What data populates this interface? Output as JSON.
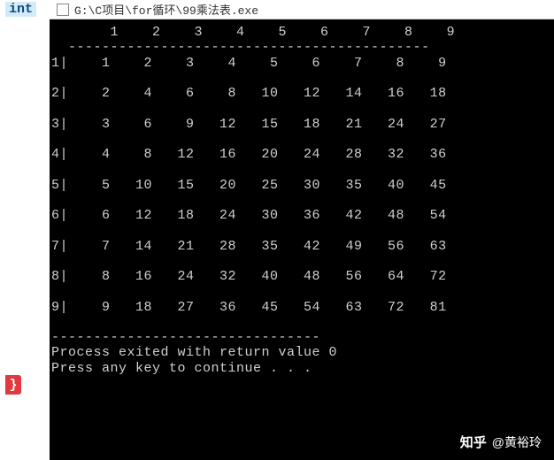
{
  "editor": {
    "keyword": "int",
    "brace": "}"
  },
  "window": {
    "title": "G:\\C项目\\for循环\\99乘法表.exe"
  },
  "chart_data": {
    "type": "table",
    "title": "9x9 multiplication table",
    "col_headers": [
      1,
      2,
      3,
      4,
      5,
      6,
      7,
      8,
      9
    ],
    "row_headers": [
      1,
      2,
      3,
      4,
      5,
      6,
      7,
      8,
      9
    ],
    "rows": [
      [
        1,
        2,
        3,
        4,
        5,
        6,
        7,
        8,
        9
      ],
      [
        2,
        4,
        6,
        8,
        10,
        12,
        14,
        16,
        18
      ],
      [
        3,
        6,
        9,
        12,
        15,
        18,
        21,
        24,
        27
      ],
      [
        4,
        8,
        12,
        16,
        20,
        24,
        28,
        32,
        36
      ],
      [
        5,
        10,
        15,
        20,
        25,
        30,
        35,
        40,
        45
      ],
      [
        6,
        12,
        18,
        24,
        30,
        36,
        42,
        48,
        54
      ],
      [
        7,
        14,
        21,
        28,
        35,
        42,
        49,
        56,
        63
      ],
      [
        8,
        16,
        24,
        32,
        40,
        48,
        56,
        64,
        72
      ],
      [
        9,
        18,
        27,
        36,
        45,
        54,
        63,
        72,
        81
      ]
    ]
  },
  "console": {
    "divider_top": "  -------------------------------------------",
    "divider_bottom": "--------------------------------",
    "exit_line": "Process exited with return value 0",
    "continue_line": "Press any key to continue . . ."
  },
  "watermark": {
    "site": "知乎",
    "author": "@黄裕玲"
  }
}
